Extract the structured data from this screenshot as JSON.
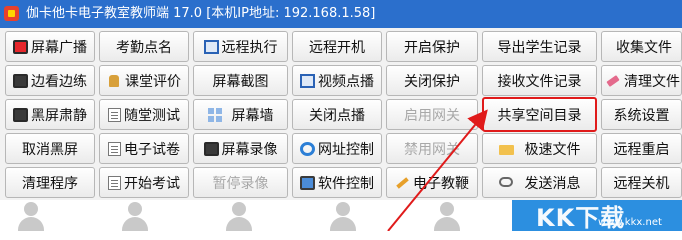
{
  "window": {
    "title": "伽卡他卡电子教室教师端 17.0 [本机IP地址: 192.168.1.58]"
  },
  "toolbar": {
    "buttons": [
      {
        "label": "屏幕广播",
        "icon": "monitor-red-icon",
        "disabled": false
      },
      {
        "label": "考勤点名",
        "icon": null,
        "disabled": false
      },
      {
        "label": "远程执行",
        "icon": "terminal-icon",
        "disabled": false
      },
      {
        "label": "远程开机",
        "icon": null,
        "disabled": false
      },
      {
        "label": "开启保护",
        "icon": null,
        "disabled": false
      },
      {
        "label": "导出学生记录",
        "icon": null,
        "disabled": false
      },
      {
        "label": "收集文件",
        "icon": null,
        "disabled": false
      },
      {
        "label": "边看边练",
        "icon": "monitor-dark-icon",
        "disabled": false
      },
      {
        "label": "课堂评价",
        "icon": "thumbs-up-icon",
        "disabled": false
      },
      {
        "label": "屏幕截图",
        "icon": null,
        "disabled": false
      },
      {
        "label": "视频点播",
        "icon": "video-icon",
        "disabled": false
      },
      {
        "label": "关闭保护",
        "icon": null,
        "disabled": false
      },
      {
        "label": "接收文件记录",
        "icon": null,
        "disabled": false
      },
      {
        "label": "清理文件",
        "icon": "eraser-icon",
        "disabled": false
      },
      {
        "label": "黑屏肃静",
        "icon": "monitor-dark-icon",
        "disabled": false
      },
      {
        "label": "随堂测试",
        "icon": "doc-icon",
        "disabled": false
      },
      {
        "label": "屏幕墙",
        "icon": "grid-icon",
        "disabled": false
      },
      {
        "label": "关闭点播",
        "icon": null,
        "disabled": false
      },
      {
        "label": "启用网关",
        "icon": null,
        "disabled": true
      },
      {
        "label": "共享空间目录",
        "icon": null,
        "disabled": false
      },
      {
        "label": "系统设置",
        "icon": null,
        "disabled": false
      },
      {
        "label": "取消黑屏",
        "icon": null,
        "disabled": false
      },
      {
        "label": "电子试卷",
        "icon": "doc-icon",
        "disabled": false
      },
      {
        "label": "屏幕录像",
        "icon": "monitor-dark-icon",
        "disabled": false
      },
      {
        "label": "网址控制",
        "icon": "ie-icon",
        "disabled": false
      },
      {
        "label": "禁用网关",
        "icon": null,
        "disabled": true
      },
      {
        "label": "极速文件",
        "icon": "folder-icon",
        "disabled": false
      },
      {
        "label": "远程重启",
        "icon": null,
        "disabled": false
      },
      {
        "label": "清理程序",
        "icon": null,
        "disabled": false
      },
      {
        "label": "开始考试",
        "icon": "doc-icon",
        "disabled": false
      },
      {
        "label": "暂停录像",
        "icon": null,
        "disabled": true
      },
      {
        "label": "软件控制",
        "icon": "pc-ops-icon",
        "disabled": false
      },
      {
        "label": "电子教鞭",
        "icon": "pencil-icon",
        "disabled": false
      },
      {
        "label": "发送消息",
        "icon": "chat-icon",
        "disabled": false
      },
      {
        "label": "远程关机",
        "icon": null,
        "disabled": false
      }
    ]
  },
  "watermark": {
    "logo": "KK下载",
    "site": "www.kkx.net"
  },
  "colors": {
    "titlebar": "#2b6fcc",
    "highlight": "#e01b1b",
    "accent_panel": "#2c8fe0"
  }
}
